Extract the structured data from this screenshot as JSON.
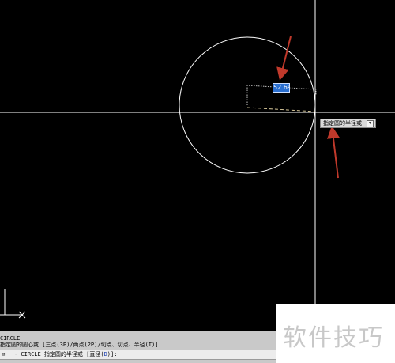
{
  "canvas": {
    "radius_value": "52.69",
    "tooltip_text": "指定圆的半径或",
    "tooltip_button_icon": "dropdown-arrow-icon",
    "colors": {
      "background": "#000000",
      "circle": "#ffffff",
      "crosshair": "#ffffff",
      "rubber_band": "#d8c89a",
      "annotation_arrow": "#c0392b",
      "input_fill": "#2a6fd0"
    }
  },
  "command_line": {
    "history": [
      "CIRCLE",
      "指定圆的圆心或 [三点(3P)/两点(2P)/切点、切点、半径(T)]:"
    ],
    "prompt_marker": "⊠",
    "prompt_prefix": "- CIRCLE 指定圆的半径或 [直径(",
    "prompt_option_key": "D",
    "prompt_suffix": ")]:"
  },
  "watermark": {
    "text": "软件技巧"
  }
}
